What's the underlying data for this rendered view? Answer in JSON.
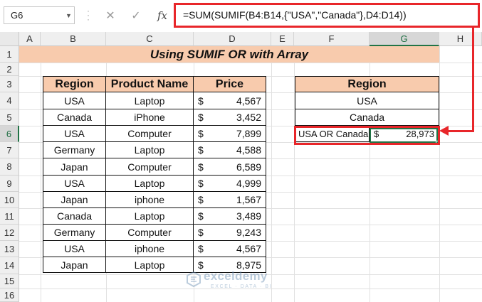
{
  "namebox": {
    "value": "G6"
  },
  "formula_bar": {
    "fx_label": "fx",
    "formula": "=SUM(SUMIF(B4:B14,{\"USA\",\"Canada\"},D4:D14))"
  },
  "columns": [
    "A",
    "B",
    "C",
    "D",
    "E",
    "F",
    "G",
    "H"
  ],
  "rows": [
    "1",
    "2",
    "3",
    "4",
    "5",
    "6",
    "7",
    "8",
    "9",
    "10",
    "11",
    "12",
    "13",
    "14",
    "15",
    "16"
  ],
  "selected_cell": {
    "column": "G",
    "row": "6"
  },
  "title": "Using SUMIF OR with Array",
  "table": {
    "headers": [
      "Region",
      "Product Name",
      "Price"
    ],
    "currency_symbol": "$",
    "rows": [
      {
        "region": "USA",
        "product": "Laptop",
        "price": "4,567"
      },
      {
        "region": "Canada",
        "product": "iPhone",
        "price": "3,452"
      },
      {
        "region": "USA",
        "product": "Computer",
        "price": "7,899"
      },
      {
        "region": "Germany",
        "product": "Laptop",
        "price": "4,588"
      },
      {
        "region": "Japan",
        "product": "Computer",
        "price": "6,589"
      },
      {
        "region": "USA",
        "product": "Laptop",
        "price": "4,999"
      },
      {
        "region": "Japan",
        "product": "iphone",
        "price": "1,567"
      },
      {
        "region": "Canada",
        "product": "Laptop",
        "price": "3,489"
      },
      {
        "region": "Germany",
        "product": "Computer",
        "price": "9,243"
      },
      {
        "region": "USA",
        "product": "iphone",
        "price": "4,567"
      },
      {
        "region": "Japan",
        "product": "Laptop",
        "price": "8,975"
      }
    ]
  },
  "criteria": {
    "header": "Region",
    "values": [
      "USA",
      "Canada"
    ],
    "result_label": "USA OR Canada",
    "result_currency": "$",
    "result_value": "28,973"
  },
  "watermark": {
    "name": "exceldemy",
    "tagline": "EXCEL · DATA · BI"
  },
  "colors": {
    "header_fill": "#f8cbad",
    "highlight": "#e8262a",
    "excel_green": "#217346"
  }
}
